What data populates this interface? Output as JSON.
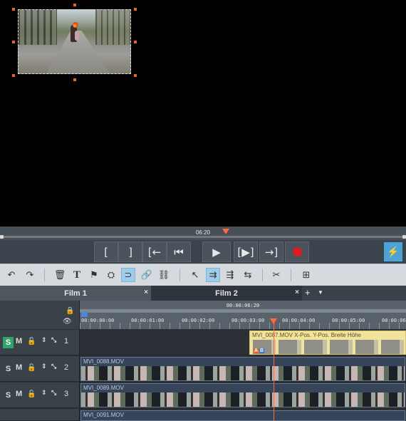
{
  "preview": {
    "timecode": "06:20"
  },
  "transport": {
    "buttons": [
      {
        "name": "mark-in-button",
        "glyph": "["
      },
      {
        "name": "mark-out-button",
        "glyph": "]"
      },
      {
        "name": "go-to-in-button",
        "glyph": "[←"
      },
      {
        "name": "previous-button",
        "glyph": "⏮"
      },
      {
        "name": "play-button",
        "glyph": "▶"
      },
      {
        "name": "play-range-button",
        "glyph": "[▶]"
      },
      {
        "name": "go-to-out-button",
        "glyph": "→]"
      },
      {
        "name": "record-button",
        "glyph": ""
      }
    ],
    "power_glyph": "⚡"
  },
  "toolbar": {
    "undo": "↶",
    "redo": "↷",
    "delete": "🗑",
    "text": "T",
    "marker": "⚑",
    "find": "⛭",
    "magnet": "⊃",
    "link": "🔗",
    "unlink": "⛓",
    "pointer": "↖",
    "mode2": "⇉",
    "mode3": "⇶",
    "mode4": "⇆",
    "cut": "✂",
    "insert": "⊞"
  },
  "tabs": [
    {
      "label": "Film 1",
      "close": "×"
    },
    {
      "label": "Film 2",
      "close": "×"
    }
  ],
  "tab_add": "+",
  "tab_menu": "▼",
  "ruler": {
    "total": "00:00:06:20",
    "ticks": [
      "00:00:00:00",
      "00:00:01:00",
      "00:00:02:00",
      "00:00:03:00",
      "00:00:04:00",
      "00:00:05:00",
      "00:00:06"
    ]
  },
  "tracks": [
    {
      "num": "1",
      "solo": "S",
      "mute": "M",
      "lock": "🔓",
      "arrows": "⇕",
      "expand": "⤡"
    },
    {
      "num": "2",
      "solo": "S",
      "mute": "M",
      "lock": "🔓",
      "arrows": "⇕",
      "expand": "⤡"
    },
    {
      "num": "3",
      "solo": "S",
      "mute": "M",
      "lock": "🔓",
      "arrows": "⇕",
      "expand": "⤡"
    }
  ],
  "clips": {
    "track1": {
      "title": "MVI_0087.MOV   X-Pos.  Y-Pos.  Breite  Höhe",
      "badge_a": "A",
      "badge_b": "B"
    },
    "track2": {
      "title": "MVI_0088.MOV"
    },
    "track3": {
      "title": "MVI_0089.MOV"
    },
    "track4": {
      "title": "MVI_0091.MOV"
    }
  }
}
